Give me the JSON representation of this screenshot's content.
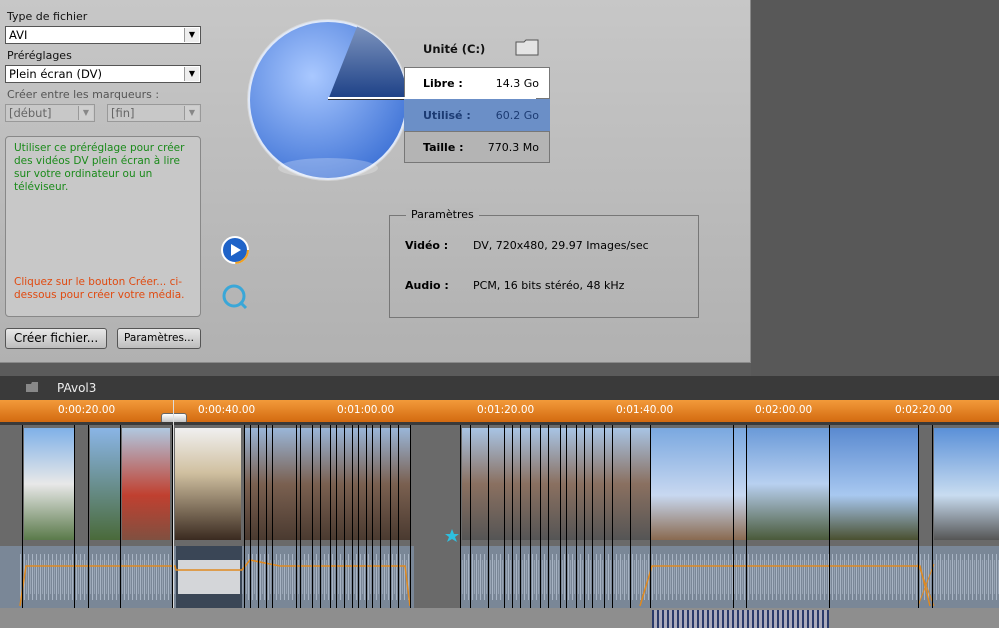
{
  "file_type": {
    "label": "Type de fichier",
    "value": "AVI"
  },
  "presets": {
    "label": "Préréglages",
    "value": "Plein écran (DV)"
  },
  "markers": {
    "label": "Créer entre les marqueurs :",
    "start": "[début]",
    "end": "[fin]"
  },
  "description": {
    "info": "Utiliser ce préréglage pour créer des vidéos DV plein écran à lire sur votre ordinateur ou un téléviseur.",
    "hint": "Cliquez sur le bouton Créer... ci-dessous pour créer votre média.",
    "info_color": "#1a8a1a",
    "hint_color": "#e04a10"
  },
  "buttons": {
    "create": "Créer fichier...",
    "settings": "Paramètres..."
  },
  "drive": {
    "unit_label": "Unité (C:)",
    "free_label": "Libre :",
    "free_value": "14.3 Go",
    "used_label": "Utilisé :",
    "used_value": "60.2 Go",
    "size_label": "Taille :",
    "size_value": "770.3 Mo",
    "used_fraction": 0.81
  },
  "parameters": {
    "title": "Paramètres",
    "video_label": "Vidéo :",
    "video_value": "DV, 720x480, 29.97 Images/sec",
    "audio_label": "Audio :",
    "audio_value": "PCM, 16 bits stéréo, 48 kHz"
  },
  "timeline": {
    "project_name": "PAvol3",
    "ticks": [
      "0:00:20.00",
      "0:00:40.00",
      "0:01:00.00",
      "0:01:20.00",
      "0:01:40.00",
      "0:02:00.00",
      "0:02:20.00"
    ]
  },
  "icons": {
    "folder": "folder-icon",
    "wmp": "windows-media-icon",
    "quicktime": "quicktime-icon",
    "project_folder": "folder-icon",
    "marker_star": "star-icon"
  }
}
